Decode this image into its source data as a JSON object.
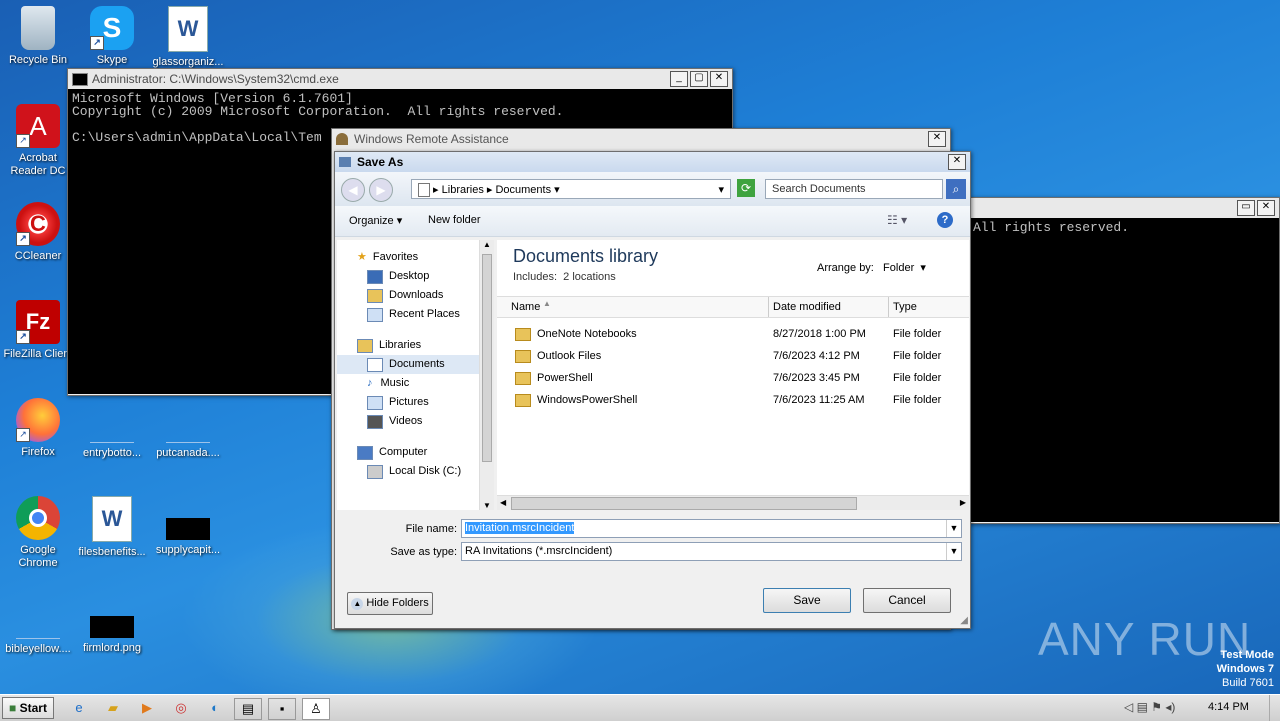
{
  "desktop": {
    "icons": [
      {
        "label": "Recycle Bin",
        "glyph": "🗑"
      },
      {
        "label": "Skype",
        "glyph": "S"
      },
      {
        "label": "glassorganiz...",
        "glyph": "W"
      },
      {
        "label": "Acrobat Reader DC",
        "glyph": "A"
      },
      {
        "label": "CCleaner",
        "glyph": "C"
      },
      {
        "label": "FileZilla Client",
        "glyph": "Fz"
      },
      {
        "label": "Firefox",
        "glyph": "◉"
      },
      {
        "label": "entrybotto...",
        "glyph": ""
      },
      {
        "label": "putcanada....",
        "glyph": ""
      },
      {
        "label": "Google Chrome",
        "glyph": "◎"
      },
      {
        "label": "filesbenefits...",
        "glyph": "W"
      },
      {
        "label": "supplycapit...",
        "glyph": ""
      },
      {
        "label": "bibleyellow....",
        "glyph": ""
      },
      {
        "label": "firmlord.png",
        "glyph": ""
      }
    ],
    "watermark": "ANY RUN",
    "mode_lines": [
      "Test Mode",
      "Windows 7",
      "Build 7601"
    ]
  },
  "cmd": {
    "title": "Administrator: C:\\Windows\\System32\\cmd.exe",
    "lines": [
      "Microsoft Windows [Version 6.1.7601]",
      "Copyright (c) 2009 Microsoft Corporation.  All rights reserved.",
      "",
      "C:\\Users\\admin\\AppData\\Local\\Tem"
    ]
  },
  "cmd2": {
    "text": "All rights reserved."
  },
  "ra": {
    "title": "Windows Remote Assistance"
  },
  "dialog": {
    "title": "Save As",
    "breadcrumb": [
      "Libraries",
      "Documents"
    ],
    "search_placeholder": "Search Documents",
    "organize": "Organize",
    "new_folder": "New folder",
    "nav": {
      "favorites": "Favorites",
      "desktop": "Desktop",
      "downloads": "Downloads",
      "recent": "Recent Places",
      "libraries": "Libraries",
      "documents": "Documents",
      "music": "Music",
      "pictures": "Pictures",
      "videos": "Videos",
      "computer": "Computer",
      "localdisk": "Local Disk (C:)"
    },
    "library_title": "Documents library",
    "includes_label": "Includes:",
    "includes_value": "2 locations",
    "arrange_label": "Arrange by:",
    "arrange_value": "Folder",
    "columns": [
      "Name",
      "Date modified",
      "Type"
    ],
    "files": [
      {
        "name": "OneNote Notebooks",
        "date": "8/27/2018 1:00 PM",
        "type": "File folder"
      },
      {
        "name": "Outlook Files",
        "date": "7/6/2023 4:12 PM",
        "type": "File folder"
      },
      {
        "name": "PowerShell",
        "date": "7/6/2023 3:45 PM",
        "type": "File folder"
      },
      {
        "name": "WindowsPowerShell",
        "date": "7/6/2023 11:25 AM",
        "type": "File folder"
      }
    ],
    "filename_label": "File name:",
    "filename_value": "Invitation.msrcIncident",
    "savetype_label": "Save as type:",
    "savetype_value": "RA Invitations (*.msrcIncident)",
    "hide_folders": "Hide Folders",
    "save": "Save",
    "cancel": "Cancel"
  },
  "taskbar": {
    "start": "Start",
    "time": "4:14 PM"
  }
}
